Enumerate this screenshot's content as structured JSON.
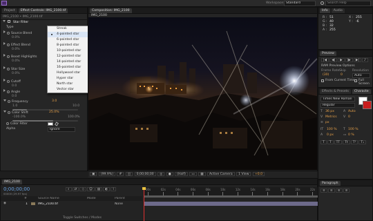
{
  "menubar": {
    "workspace_label": "Workspace:",
    "workspace_value": "Standard",
    "search_placeholder": "Search Help"
  },
  "left_panel": {
    "tabs": [
      "Project",
      "Effect Controls: IMG_2100.tif"
    ],
    "breadcrumb": "IMG_2100 • IMG_2100.tif",
    "effect_name": "Star Filter",
    "effect_reset": "Reset",
    "effect_about": "Abo",
    "type_label": "Type",
    "type_value": "4-pointed star",
    "params": [
      {
        "label": "Source Blend",
        "value": "",
        "min": "0.0%",
        "max": "",
        "level": 0
      },
      {
        "label": "Effect Blend",
        "value": "",
        "min": "0.0%",
        "max": "",
        "level": 0
      },
      {
        "label": "Boost Highlights",
        "value": "",
        "min": "0.0%",
        "max": "",
        "level": 0
      },
      {
        "label": "Star Size",
        "value": "",
        "min": "0.0%",
        "max": "",
        "level": 0
      },
      {
        "label": "Cutoff",
        "value": "",
        "min": "0.0",
        "max": "",
        "level": 0
      },
      {
        "label": "Angle",
        "value": "",
        "min": "0.0",
        "max": "",
        "level": 0
      },
      {
        "label": "Frequency",
        "value": "3.0",
        "min": "1.0",
        "max": "10.0",
        "level": 0.22
      }
    ],
    "color_shift_label": "Color Shift",
    "color_shift_value": "25.0%",
    "color_shift_min": "-100.0%",
    "color_shift_max": "100.0%",
    "color_shift_level": 0.62,
    "color_filter_label": "Color Filter",
    "alpha_label": "Alpha",
    "alpha_value": "Ignore"
  },
  "star_type_menu": {
    "items": [
      "Streak",
      "4-pointed star",
      "6-pointed star",
      "8-pointed star",
      "10-pointed star",
      "12-pointed star",
      "14-pointed star",
      "16-pointed star",
      "Hollywood star",
      "Hyper star",
      "North star",
      "Vector star"
    ],
    "selected_index": 1
  },
  "composition": {
    "tab": "Composition: IMG_2100",
    "subtab": "IMG_2100",
    "toolbar": {
      "zoom": "(99.9%)",
      "time": "0;00;00;00",
      "resolution": "(Half)",
      "view": "Active Camera",
      "views": "1 View",
      "exposure": "+0.0"
    }
  },
  "info_panel": {
    "tabs": [
      "Info",
      "Audio"
    ],
    "r_label": "R :",
    "r_value": "51",
    "g_label": "G :",
    "g_value": "40",
    "b_label": "B :",
    "b_value": "32",
    "a_label": "A :",
    "a_value": "255",
    "x_label": "X :",
    "x_value": "255",
    "y_label": "Y :",
    "y_value": "-6"
  },
  "preview_panel": {
    "tab": "Preview",
    "section": "RAM Preview Options",
    "frame_rate_label": "Frame Rate",
    "frame_rate_value": "(30)",
    "skip_label": "Skip",
    "skip_value": "0",
    "resolution_label": "Resolution",
    "resolution_value": "Auto",
    "from_current_label": "From Current Time",
    "full_screen_label": "Full Screen"
  },
  "character_panel": {
    "tabs": [
      "Effects & Presets",
      "Characte"
    ],
    "font": "Times New Roman",
    "style": "Regular",
    "font_size": "36 px",
    "leading": "Auto",
    "kerning": "Metrics",
    "tracking": "0",
    "stroke_width": "px",
    "vertical_scale": "100 %",
    "horizontal_scale": "100 %",
    "baseline": "0 px",
    "tsume": "0 %"
  },
  "paragraph_panel": {
    "tab": "Paragraph"
  },
  "timeline": {
    "tab": "IMG_2100",
    "timecode": "0;00;00;00",
    "fps_info": "00000 (29.97 fps)",
    "columns": [
      "#",
      "Source Name",
      "Mode",
      "Parent"
    ],
    "layer_index": "1",
    "layer_name": "IMG_2100.tif",
    "layer_parent": "None",
    "ruler_marks": [
      "00s",
      "02s",
      "04s",
      "06s",
      "08s",
      "10s",
      "12s",
      "14s",
      "16s",
      "18s",
      "20s",
      "22s"
    ],
    "toggle_label": "Toggle Switches / Modes"
  },
  "colors": {
    "accent_orange": "#e8a24a",
    "accent_blue": "#6aa2e0",
    "panel_bg": "#262626",
    "menu_bg": "#f2f2f2"
  }
}
